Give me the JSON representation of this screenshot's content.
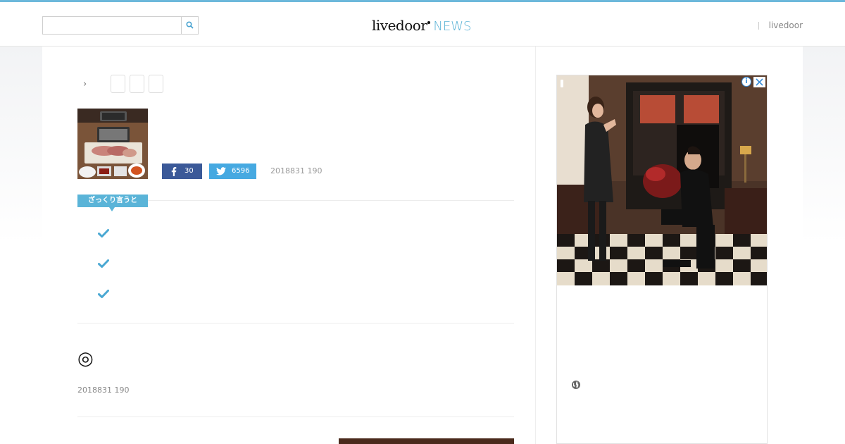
{
  "header": {
    "search": {
      "value": "",
      "placeholder": ""
    },
    "logo": {
      "word": "livedoor",
      "suffix": "NEWS"
    },
    "right_link": "livedoor"
  },
  "article": {
    "like_count": "30",
    "tweet_count": "6596",
    "date_top": "2018831 190",
    "summary_label": "ざっくり言うと",
    "summary_points": 3,
    "date_bottom": "2018831 190",
    "circle_symbol": "◎"
  },
  "colors": {
    "accent": "#5ab4d8",
    "facebook": "#3b5998",
    "twitter": "#46a9e1",
    "top_border": "#6cb8db"
  },
  "icons": [
    "search-icon",
    "chevron-right-icon",
    "facebook-icon",
    "twitter-icon",
    "check-icon",
    "info-icon",
    "close-icon",
    "globe-icon"
  ]
}
